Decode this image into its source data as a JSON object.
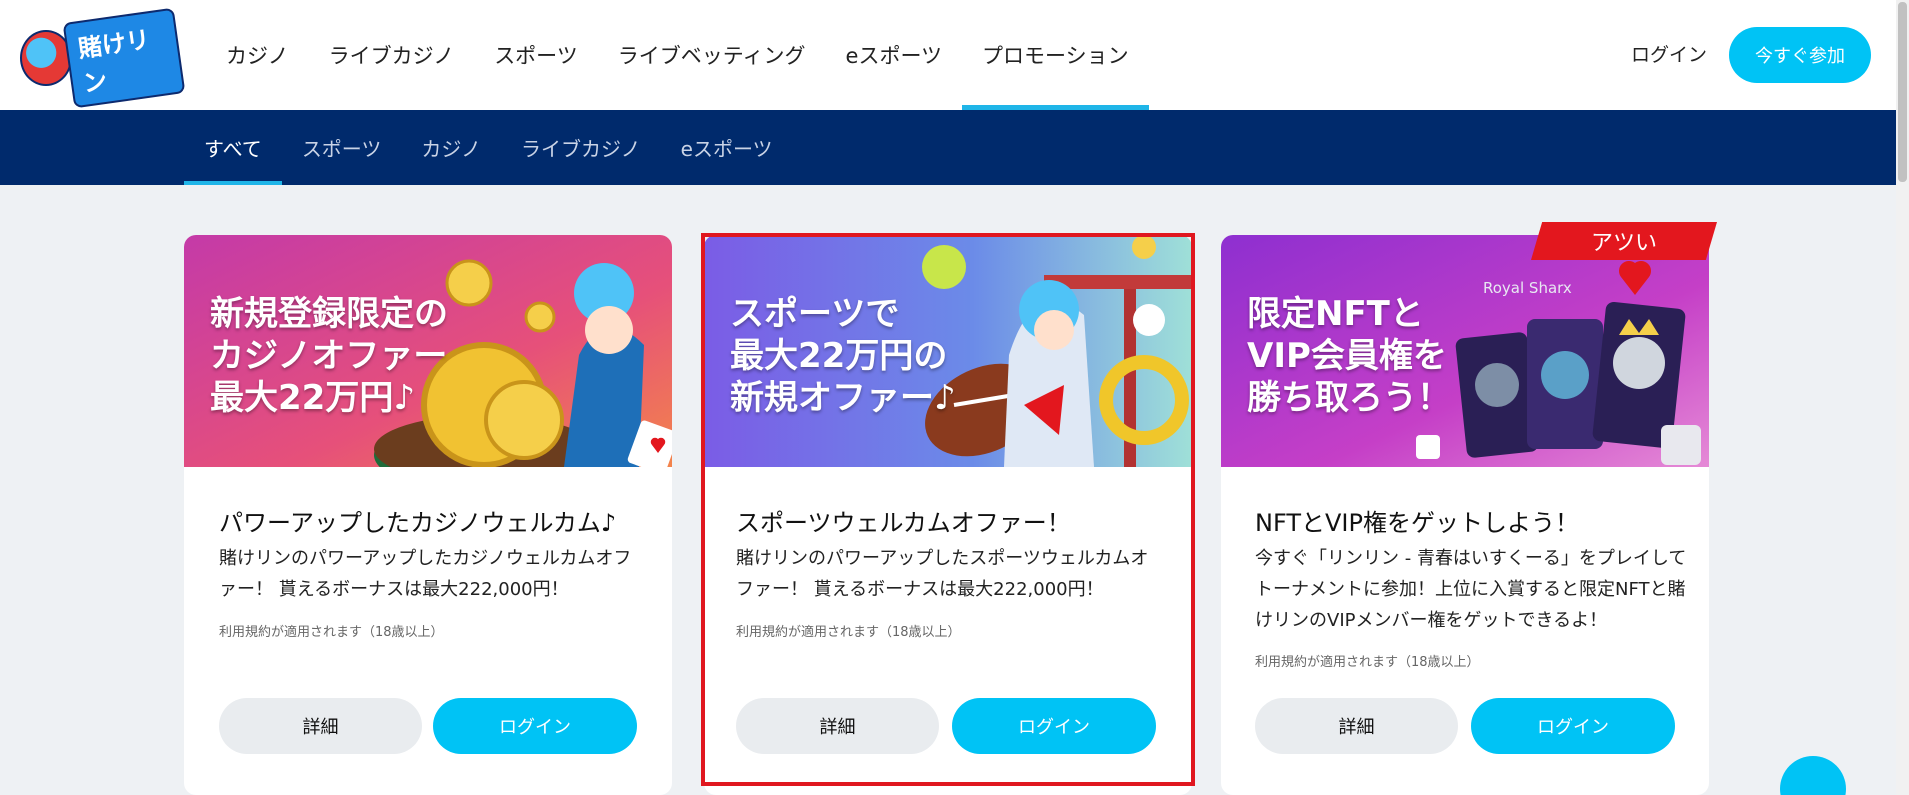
{
  "header": {
    "logo_text": "賭けリン",
    "nav": [
      "カジノ",
      "ライブカジノ",
      "スポーツ",
      "ライブベッティング",
      "eスポーツ",
      "プロモーション"
    ],
    "active_nav": "プロモーション",
    "login_label": "ログイン",
    "join_label": "今すぐ参加"
  },
  "subnav": {
    "items": [
      "すべて",
      "スポーツ",
      "カジノ",
      "ライブカジノ",
      "eスポーツ"
    ],
    "active": "すべて"
  },
  "cards": [
    {
      "banner_text": "新規登録限定の\nカジノオファー\n最大22万円♪",
      "title": "パワーアップしたカジノウェルカム♪",
      "desc": "賭けリンのパワーアップしたカジノウェルカムオファー！ 貰えるボーナスは最大222,000円！",
      "terms": "利用規約が適用されます（18歳以上）",
      "detail_label": "詳細",
      "login_label": "ログイン"
    },
    {
      "banner_text": "スポーツで\n最大22万円の\n新規オファー♪",
      "title": "スポーツウェルカムオファー！",
      "desc": "賭けリンのパワーアップしたスポーツウェルカムオファー！ 貰えるボーナスは最大222,000円！",
      "terms": "利用規約が適用されます（18歳以上）",
      "detail_label": "詳細",
      "login_label": "ログイン"
    },
    {
      "banner_text": "限定NFTと\nVIP会員権を\n勝ち取ろう！",
      "title": "NFTとVIP権をゲットしよう！",
      "desc": "今すぐ「リンリン - 青春はいすくーる」をプレイしてトーナメントに参加！上位に入賞すると限定NFTと賭けリンのVIPメンバー権をゲットできるよ！",
      "terms": "利用規約が適用されます（18歳以上）",
      "detail_label": "詳細",
      "login_label": "ログイン",
      "ribbon": "アツい",
      "banner_brand": "Royal Sharx"
    }
  ],
  "colors": {
    "accent": "#00c3f5",
    "subnav_bg": "#002a6c",
    "highlight": "#e0171f",
    "ribbon": "#e3171e"
  }
}
